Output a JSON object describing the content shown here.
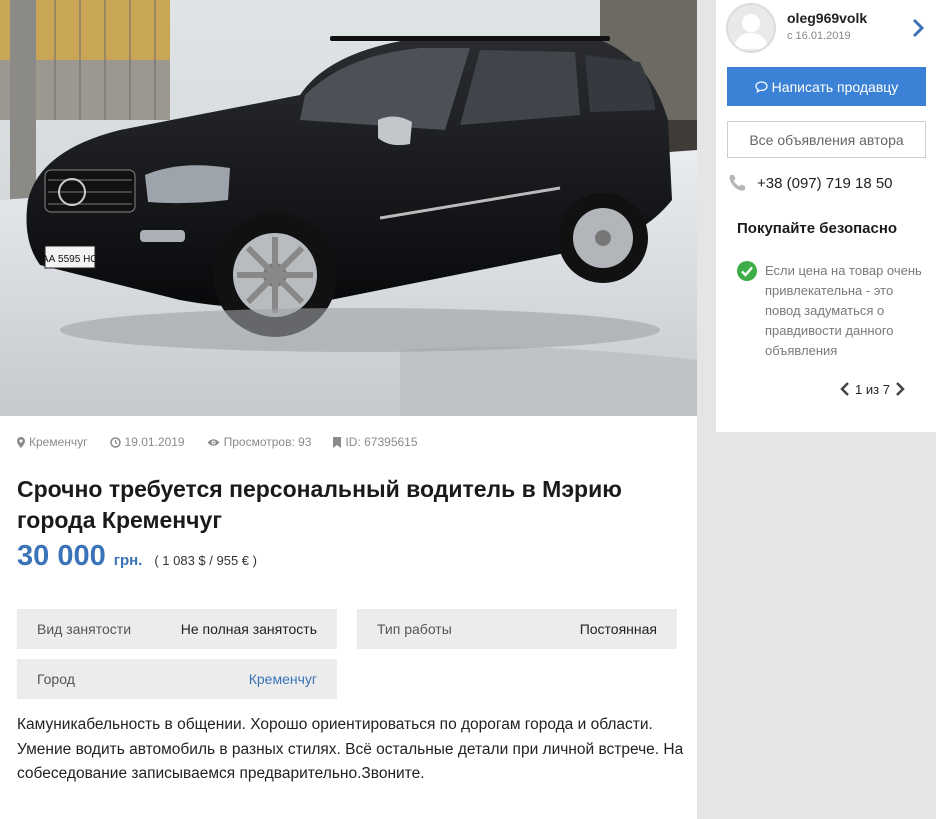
{
  "listing": {
    "photo_icon": "car-photo",
    "location": "Кременчуг",
    "date": "19.01.2019",
    "views": "Просмотров: 93",
    "id": "ID: 67395615",
    "title": "Срочно требуется персональный водитель в Мэрию города Кременчуг",
    "price": "30 000",
    "currency": "грн.",
    "converted": "( 1 083 $ / 955 € )",
    "params": [
      {
        "key": "Вид занятости",
        "value": "Не полная занятость"
      },
      {
        "key": "Тип работы",
        "value": "Постоянная"
      },
      {
        "key": "Город",
        "value": "Кременчуг"
      }
    ],
    "description": "Камуникабельность в общении. Хорошо ориентироваться по дорогам города и области. Умение водить автомобиль в разных стилях. Всё остальные детали при личной встрече. На собеседование записываемся предварительно.Звоните.",
    "license_plate": "АА 5595 НО"
  },
  "seller": {
    "username": "oleg969volk",
    "since": "с 16.01.2019",
    "write_button": "Написать продавцу",
    "all_ads_button": "Все объявления автора",
    "phone": "+38 (097) 719 18 50"
  },
  "safety": {
    "title": "Покупайте безопасно",
    "tip": "Если цена на товар очень привлекательна - это повод задуматься о правдивости данного объявления",
    "page": "1",
    "of": "из",
    "total": "7"
  },
  "colors": {
    "accent": "#3b73b9",
    "button": "#3b82d6",
    "check": "#3fae49"
  }
}
